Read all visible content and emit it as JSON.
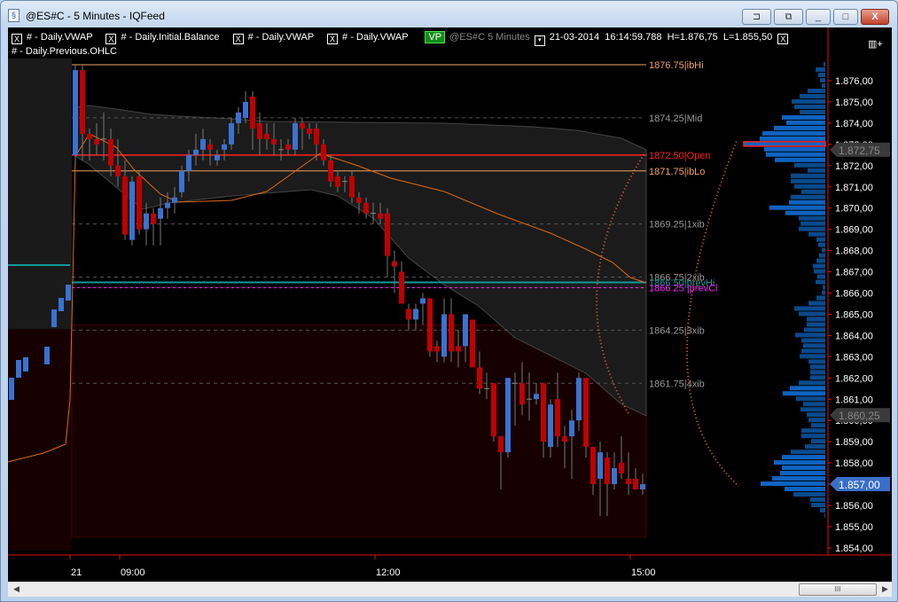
{
  "window": {
    "title": "@ES#C - 5 Minutes - IQFeed",
    "buttons": {
      "pin": "⊐",
      "restore_alt": "⧉",
      "minimize": "_",
      "maximize": "□",
      "close": "X"
    }
  },
  "legend": {
    "indicators": [
      "# - Daily.VWAP",
      "# - Daily.Initial.Balance",
      "# - Daily.VWAP",
      "# - Daily.VWAP"
    ],
    "close_glyph": "X",
    "vp_badge": "VP",
    "symbol": "@ES#C  5 Minutes",
    "dropdown_glyph": "▾",
    "date": "21-03-2014",
    "time": "16:14:59.788",
    "high": "H=1.876,75",
    "low": "L=1.855,50",
    "second_row": "# - Daily.Previous.OHLC",
    "panel_icon": "▥+"
  },
  "colors": {
    "up": "#3a72d0",
    "down": "#c00000",
    "ib": "#f0a060",
    "open": "#ff2020",
    "prevHi": "#0f9a9a",
    "prevCl": "#ff22ff",
    "vwap": "#e06a10",
    "grid": "#555555",
    "axis": "#e01010",
    "profile": "#0a4a8c",
    "profile_hi": "#0e63c0"
  },
  "chart_data": {
    "type": "candlestick",
    "ylim": [
      1853.5,
      1877.25
    ],
    "y_ticks": [
      "1.876,00",
      "1.875,00",
      "1.874,00",
      "1.873,00",
      "1.872,00",
      "1.871,00",
      "1.870,00",
      "1.869,00",
      "1.868,00",
      "1.867,00",
      "1.866,00",
      "1.865,00",
      "1.864,00",
      "1.863,00",
      "1.862,00",
      "1.861,00",
      "1.860,00",
      "1.859,00",
      "1.858,00",
      "1.857,00",
      "1.856,00",
      "1.855,00",
      "1.854,00"
    ],
    "x_ticks": [
      {
        "label": "21",
        "bar": 0
      },
      {
        "label": "09:00",
        "bar": 7
      },
      {
        "label": "12:00",
        "bar": 43
      },
      {
        "label": "15:00",
        "bar": 79
      }
    ],
    "price_markers": [
      {
        "price": 1872.75,
        "label": "1.872,75",
        "style": "grey"
      },
      {
        "price": 1860.25,
        "label": "1.860,25",
        "style": "grey"
      },
      {
        "price": 1857.0,
        "label": "1.857,00",
        "style": "current"
      }
    ],
    "levels": [
      {
        "price": 1876.75,
        "label": "1876.75|ibHi",
        "kind": "ib"
      },
      {
        "price": 1874.25,
        "label": "1874.25|Mid",
        "kind": "dash"
      },
      {
        "price": 1872.5,
        "label": "1872.50|Open",
        "kind": "open"
      },
      {
        "price": 1871.75,
        "label": "1871.75|ibLo",
        "kind": "ib"
      },
      {
        "price": 1869.25,
        "label": "1869.25|1xib",
        "kind": "dash"
      },
      {
        "price": 1866.75,
        "label": "1866.75|2xib",
        "kind": "dash"
      },
      {
        "price": 1866.5,
        "label": "1866.50|prevHi",
        "kind": "prevHi"
      },
      {
        "price": 1866.25,
        "label": "1866.25 |prevCl",
        "kind": "prevCl"
      },
      {
        "price": 1864.25,
        "label": "1864.25|3xib",
        "kind": "dash"
      },
      {
        "price": 1861.75,
        "label": "1861.75|4xib",
        "kind": "dash"
      }
    ],
    "candles_ohlc": [
      [
        1872.5,
        1876.75,
        1872,
        1876.5
      ],
      [
        1876.5,
        1876.75,
        1872.25,
        1873.5
      ],
      [
        1873.5,
        1873.75,
        1872.25,
        1873.25
      ],
      [
        1873.25,
        1874,
        1872.5,
        1873
      ],
      [
        1873.25,
        1874.5,
        1872.25,
        1873.25
      ],
      [
        1873.25,
        1873.75,
        1871.5,
        1872
      ],
      [
        1872,
        1873.25,
        1871,
        1871.5
      ],
      [
        1871.5,
        1872.25,
        1868.5,
        1868.75
      ],
      [
        1868.5,
        1871.5,
        1868.25,
        1871.25
      ],
      [
        1871.5,
        1871.75,
        1868.75,
        1869
      ],
      [
        1869,
        1870.25,
        1868.25,
        1869.75
      ],
      [
        1869.75,
        1870,
        1868.25,
        1869.25
      ],
      [
        1869.5,
        1870.5,
        1868.25,
        1870
      ],
      [
        1870,
        1870.75,
        1869.5,
        1870.25
      ],
      [
        1870.25,
        1871,
        1869.75,
        1870.5
      ],
      [
        1870.75,
        1872,
        1870.5,
        1871.75
      ],
      [
        1871.75,
        1872.75,
        1871.25,
        1872.5
      ],
      [
        1872.5,
        1873.5,
        1872,
        1872.75
      ],
      [
        1872.75,
        1873.75,
        1872.25,
        1873.25
      ],
      [
        1873,
        1873.25,
        1872,
        1872.75
      ],
      [
        1872.25,
        1872.75,
        1872,
        1872.5
      ],
      [
        1872.75,
        1873.25,
        1872.25,
        1873
      ],
      [
        1873,
        1874.25,
        1872.75,
        1874
      ],
      [
        1874,
        1874.75,
        1873.5,
        1874.5
      ],
      [
        1874.25,
        1875.5,
        1874,
        1875
      ],
      [
        1875.25,
        1875.5,
        1872.75,
        1873.75
      ],
      [
        1874,
        1874.5,
        1872.5,
        1873.25
      ],
      [
        1873.5,
        1874,
        1872.75,
        1873.25
      ],
      [
        1873.25,
        1874,
        1872.5,
        1873
      ],
      [
        1872.75,
        1873.25,
        1872.25,
        1872.75
      ],
      [
        1873,
        1873.25,
        1872.5,
        1872.75
      ],
      [
        1872.75,
        1874.25,
        1872.5,
        1874
      ],
      [
        1874,
        1874.25,
        1872.75,
        1873.75
      ],
      [
        1873.75,
        1874,
        1873.25,
        1873.5
      ],
      [
        1873.75,
        1874,
        1872.25,
        1873
      ],
      [
        1873,
        1873.25,
        1872,
        1872.25
      ],
      [
        1872.25,
        1872.5,
        1871,
        1871.25
      ],
      [
        1871.5,
        1871.75,
        1870.75,
        1871
      ],
      [
        1871.25,
        1871.5,
        1870.75,
        1871.25
      ],
      [
        1871.5,
        1871.75,
        1870.25,
        1870.5
      ],
      [
        1870.5,
        1870.75,
        1869.75,
        1870.25
      ],
      [
        1870.25,
        1870.5,
        1869.5,
        1869.75
      ],
      [
        1869.75,
        1870.25,
        1869.25,
        1869.75
      ],
      [
        1869.75,
        1870.25,
        1869.25,
        1869.5
      ],
      [
        1869.75,
        1870,
        1866.75,
        1867.75
      ],
      [
        1867.5,
        1868,
        1866,
        1867.25
      ],
      [
        1867,
        1867.5,
        1865.5,
        1865.5
      ],
      [
        1865.25,
        1865.5,
        1864.25,
        1864.75
      ],
      [
        1864.75,
        1865.5,
        1864.25,
        1865.25
      ],
      [
        1865.5,
        1866,
        1864.5,
        1865.75
      ],
      [
        1865.75,
        1865.75,
        1863,
        1863.25
      ],
      [
        1863.5,
        1863.75,
        1862.75,
        1863.25
      ],
      [
        1863,
        1865.75,
        1862.75,
        1865
      ],
      [
        1865,
        1865.75,
        1862.75,
        1863.25
      ],
      [
        1863.5,
        1864.25,
        1862.5,
        1863.25
      ],
      [
        1863.5,
        1865,
        1862.75,
        1865
      ],
      [
        1864.75,
        1864.75,
        1862.5,
        1862.5
      ],
      [
        1862.5,
        1863.25,
        1861.25,
        1861.5
      ],
      [
        1861.5,
        1862.25,
        1861,
        1861.5
      ],
      [
        1861.75,
        1861.75,
        1859,
        1859.25
      ],
      [
        1859.25,
        1859.25,
        1856.75,
        1858.5
      ],
      [
        1858.5,
        1862,
        1858.25,
        1862
      ],
      [
        1861.75,
        1862.25,
        1859.75,
        1861.75
      ],
      [
        1861.75,
        1862.75,
        1860.25,
        1860.75
      ],
      [
        1861,
        1862.25,
        1860,
        1861
      ],
      [
        1861,
        1861.75,
        1860.75,
        1861.25
      ],
      [
        1861.75,
        1861.75,
        1858.25,
        1859
      ],
      [
        1858.75,
        1861,
        1858.25,
        1860.75
      ],
      [
        1861,
        1862.25,
        1858.75,
        1859.25
      ],
      [
        1859.25,
        1859.75,
        1857.75,
        1859
      ],
      [
        1859.25,
        1860.5,
        1857.25,
        1860
      ],
      [
        1860,
        1862.25,
        1859.5,
        1862
      ],
      [
        1862,
        1862,
        1858.25,
        1858.75
      ],
      [
        1858.75,
        1858.75,
        1856.5,
        1857
      ],
      [
        1857.25,
        1859,
        1855.5,
        1858.5
      ],
      [
        1858.25,
        1858.5,
        1855.5,
        1857
      ],
      [
        1857,
        1858.5,
        1856.75,
        1857.75
      ],
      [
        1858,
        1859.25,
        1857.25,
        1857.5
      ],
      [
        1857.25,
        1858.5,
        1856.5,
        1857
      ],
      [
        1857.25,
        1857.75,
        1856.75,
        1856.75
      ],
      [
        1856.75,
        1857.5,
        1856.5,
        1857
      ]
    ],
    "volume_profile": {
      "start_price": 1876.75,
      "tick": 0.25,
      "poc": 1873.0,
      "volumes": [
        2,
        11,
        8,
        6,
        4,
        20,
        29,
        38,
        35,
        29,
        49,
        44,
        58,
        71,
        74,
        92,
        69,
        67,
        57,
        35,
        20,
        39,
        39,
        35,
        27,
        39,
        41,
        63,
        45,
        30,
        28,
        30,
        19,
        10,
        8,
        4,
        7,
        10,
        14,
        13,
        9,
        11,
        3,
        4,
        10,
        19,
        35,
        30,
        21,
        21,
        24,
        34,
        27,
        25,
        27,
        29,
        19,
        17,
        17,
        17,
        30,
        40,
        48,
        33,
        25,
        28,
        21,
        19,
        16,
        27,
        27,
        16,
        23,
        39,
        49,
        58,
        49,
        51,
        60,
        73,
        46,
        36,
        17,
        16,
        6,
        1
      ]
    }
  }
}
